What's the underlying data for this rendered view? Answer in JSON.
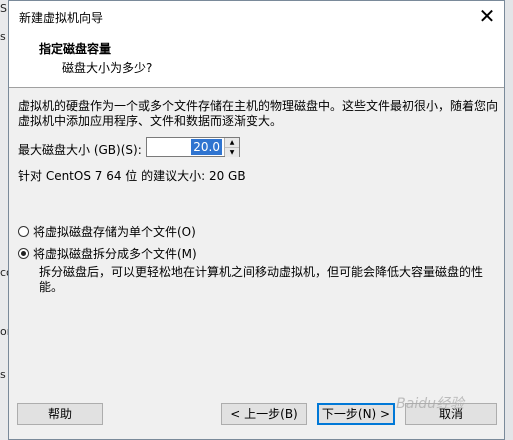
{
  "background": {
    "left_fragments": [
      "S",
      "s",
      "co",
      "or",
      "s"
    ]
  },
  "window": {
    "title": "新建虚拟机向导",
    "close_glyph": "✕"
  },
  "header": {
    "title": "指定磁盘容量",
    "subtitle": "磁盘大小为多少?"
  },
  "content": {
    "description": "虚拟机的硬盘作为一个或多个文件存储在主机的物理磁盘中。这些文件最初很小，随着您向虚拟机中添加应用程序、文件和数据而逐渐变大。",
    "max_size_label": "最大磁盘大小 (GB)(S):",
    "max_size_value": "20.0",
    "recommendation": "针对 CentOS 7 64 位 的建议大小: 20 GB",
    "options": [
      {
        "label": "将虚拟磁盘存储为单个文件(O)",
        "checked": false
      },
      {
        "label": "将虚拟磁盘拆分成多个文件(M)",
        "checked": true
      }
    ],
    "split_note": "拆分磁盘后，可以更轻松地在计算机之间移动虚拟机，但可能会降低大容量磁盘的性能。"
  },
  "buttons": {
    "help": "帮助",
    "back": "< 上一步(B)",
    "next": "下一步(N) >",
    "cancel": "取消"
  },
  "watermark": "Baidu经验",
  "colors": {
    "selection": "#2f74d0",
    "primary_border": "#0078d7"
  }
}
